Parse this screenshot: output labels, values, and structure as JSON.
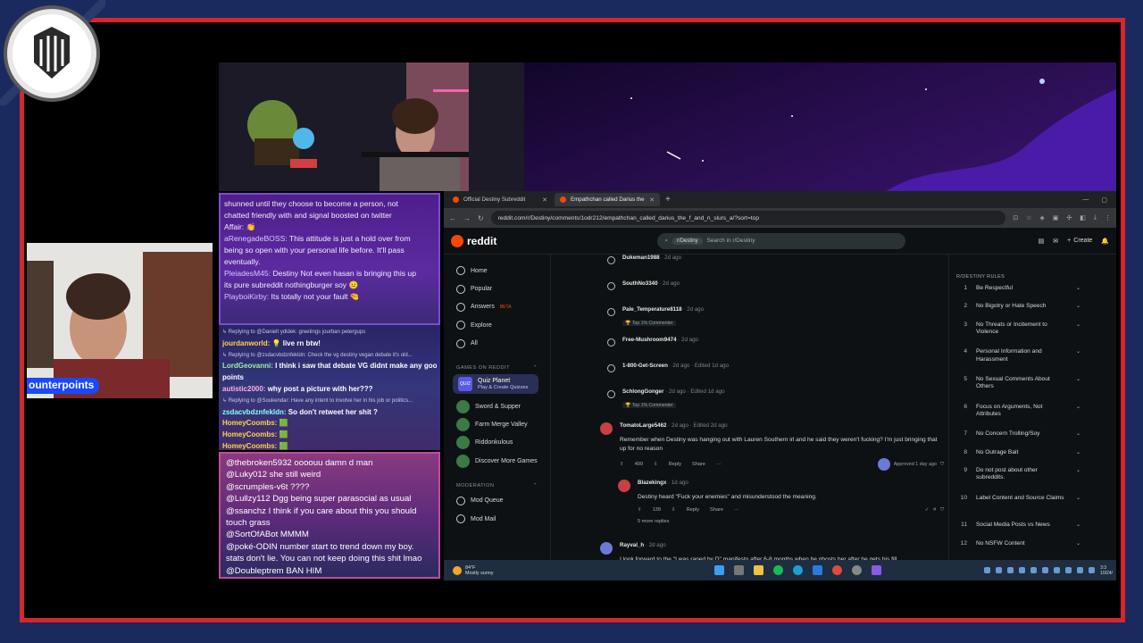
{
  "overlay": {
    "nameplate": "ounterpoints",
    "colors": {
      "frame": "#d6262e",
      "background": "#1b2a5e",
      "nameplate": "#1a48ff"
    }
  },
  "chat_top": [
    {
      "text": "shunned until they choose to become a person, not"
    },
    {
      "text": "chatted friendly with and signal boosted on twitter"
    },
    {
      "text": "Affair: 👏"
    },
    {
      "user": "aRenegadeBOSS:",
      "text": " This attitude is just a hold over from"
    },
    {
      "text": "being so open with your personal life before. It'll pass"
    },
    {
      "text": "eventually."
    },
    {
      "user": "PleiadesM45:",
      "text": " Destiny Not even hasan is bringing this up"
    },
    {
      "text": "its pure subreddit nothingburger soy 😐"
    },
    {
      "user": "PlayboiKirby:",
      "text": " Its totally not your fault 🤏"
    }
  ],
  "chat_mid": [
    {
      "small": true,
      "text": "↳ Replying to @Danielt ydidek: greetings jourban petergups"
    },
    {
      "user": "jourdanworld:",
      "cls": "u1",
      "text": " 💡 live rn btw!"
    },
    {
      "small": true,
      "text": "↳ Replying to @zsdacvbdznfekldn: Check the vg destiny vegan debate it's old..."
    },
    {
      "user": "LordGeovanni:",
      "cls": "u2",
      "text": " I think i saw that debate VG didnt make any good"
    },
    {
      "text": "points"
    },
    {
      "user": "autistic2000:",
      "cls": "u3",
      "text": " why post a picture with her???"
    },
    {
      "small": true,
      "text": "↳ Replying to @Soukendar: Have any intent to involve her in his job or politics..."
    },
    {
      "user": "zsdacvbdznfekldn:",
      "cls": "u4",
      "text": " So don't retweet her shit ?"
    },
    {
      "user": "HomeyCoombs:",
      "cls": "u1",
      "text": " 🟩"
    },
    {
      "user": "HomeyCoombs:",
      "cls": "u1",
      "text": " 🟩"
    },
    {
      "user": "HomeyCoombs:",
      "cls": "u1",
      "text": " 🟩"
    }
  ],
  "chat_bottom": [
    "@thebroken5932 oooouu damn d man",
    "@Luky012 she still weird",
    "@scrumples-v6t ????",
    "@Lullzy112 Dgg being super parasocial as usual",
    "@ssanchz I think if you care about this you should",
    "touch grass",
    "@SortOfABot MMMM",
    "@poké-ODIN number start to trend down my boy.",
    "stats don't lie. You can not keep doing this shit lmao",
    "@Doubleptrem BAN HIM"
  ],
  "browser": {
    "tabs": [
      {
        "title": "Official Destiny Subreddit",
        "active": false
      },
      {
        "title": "Empathchan called Darius the ...",
        "active": true
      }
    ],
    "url": "reddit.com/r/Destiny/comments/1odr212/empathchan_called_darius_the_f_and_n_slurs_a/?sort=top"
  },
  "reddit": {
    "logo": "reddit",
    "search_chip": "r/Destiny",
    "search_placeholder": "Search in r/Destiny",
    "create_label": "Create",
    "nav": [
      {
        "label": "Home"
      },
      {
        "label": "Popular"
      },
      {
        "label": "Answers",
        "badge": "BETA"
      },
      {
        "label": "Explore"
      },
      {
        "label": "All"
      }
    ],
    "games_header": "GAMES ON REDDIT",
    "quiz": {
      "title": "Quiz Planet",
      "subtitle": "Play & Create Quizzes"
    },
    "games": [
      "Sword & Supper",
      "Farm Merge Valley",
      "Riddonkulous",
      "Discover More Games"
    ],
    "moderation_header": "MODERATION",
    "mod_items": [
      "Mod Queue",
      "Mod Mail"
    ],
    "collapsed": [
      {
        "user": "Dukeman1988",
        "meta": "· 2d ago"
      },
      {
        "user": "SouthNo3340",
        "meta": "· 2d ago"
      },
      {
        "user": "Pale_Temperature8118",
        "meta": "· 2d ago",
        "flair": "🏆 Top 1% Commenter"
      },
      {
        "user": "Free-Mushroom9474",
        "meta": "· 2d ago"
      },
      {
        "user": "1-800-Get-Screen",
        "meta": "· 2d ago · Edited 1d ago"
      },
      {
        "user": "SchlongGonger",
        "meta": "· 2d ago · Edited 1d ago",
        "flair": "🏆 Top 1% Commenter"
      }
    ],
    "comment": {
      "user": "TomatoLarge5462",
      "meta": "· 2d ago · Edited 2d ago",
      "body": "Remember when Destiny was hanging out with Lauren Southern irl and he said they weren't fucking? I'm just bringing that up for no reason",
      "votes": "499",
      "reply": "Reply",
      "share": "Share",
      "approved": "Approved 1 day ago"
    },
    "reply": {
      "user": "Blazekingx",
      "meta": "· 1d ago",
      "body": "Destiny heard \"Fuck your enemies\" and misunderstood the meaning.",
      "votes": "139",
      "reply": "Reply",
      "share": "Share",
      "more": "5 more replies"
    },
    "next": {
      "user": "Rayval_h",
      "meta": "· 2d ago",
      "body": "I look forward to the \"I was raped by D\" manifesto after 6-8 months when he ghosts her after he gets his fill."
    },
    "rules_header": "R/DESTINY RULES",
    "rules": [
      "Be Respectful",
      "No Bigotry or Hate Speech",
      "No Threats or Incitement to Violence",
      "Personal Information and Harassment",
      "No Sexual Comments About Others",
      "Focus on Arguments, Not Attributes",
      "No Concern Trolling/Soy",
      "No Outrage Bait",
      "Do not post about other subreddits.",
      "Label Content and Source Claims",
      "Social Media Posts vs News",
      "No NSFW Content"
    ]
  },
  "taskbar": {
    "temp": "84°F",
    "weather": "Mostly sunny",
    "time": "3:3",
    "date": "10/24/"
  }
}
